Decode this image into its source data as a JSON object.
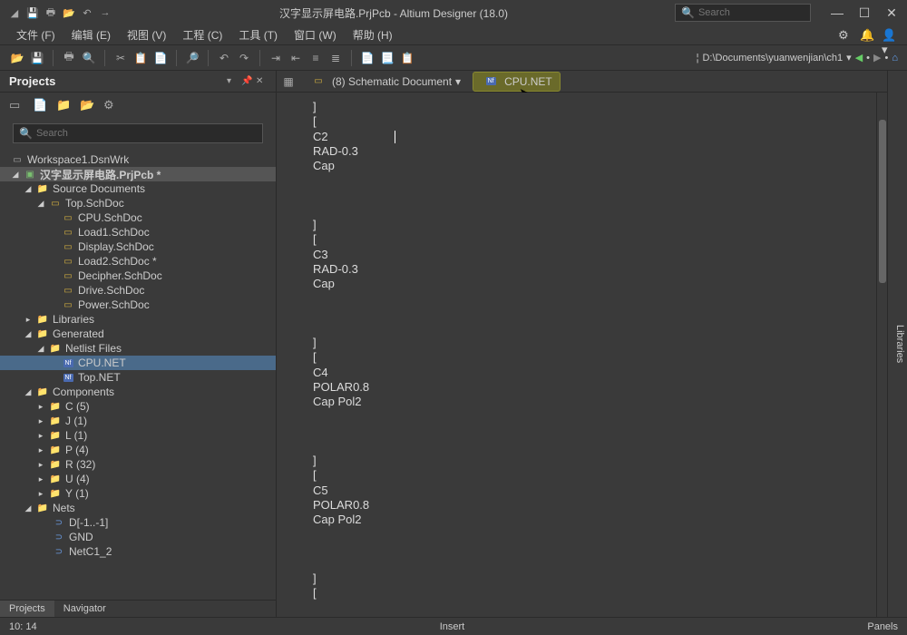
{
  "titlebar": {
    "title": "汉字显示屏电路.PrjPcb - Altium Designer (18.0)",
    "search_placeholder": "Search"
  },
  "menubar": {
    "items": [
      "文件 (F)",
      "编辑 (E)",
      "视图 (V)",
      "工程 (C)",
      "工具 (T)",
      "窗口 (W)",
      "帮助 (H)"
    ]
  },
  "toolbar_right": {
    "path": "D:\\Documents\\yuanwenjian\\ch1"
  },
  "projects_panel": {
    "title": "Projects",
    "search_placeholder": "Search"
  },
  "tree": {
    "workspace": "Workspace1.DsnWrk",
    "project": "汉字显示屏电路.PrjPcb *",
    "source_docs_label": "Source Documents",
    "source_docs": [
      "Top.SchDoc",
      "CPU.SchDoc",
      "Load1.SchDoc",
      "Display.SchDoc",
      "Load2.SchDoc *",
      "Decipher.SchDoc",
      "Drive.SchDoc",
      "Power.SchDoc"
    ],
    "libraries_label": "Libraries",
    "generated_label": "Generated",
    "netlist_label": "Netlist Files",
    "netlist_files": [
      "CPU.NET",
      "Top.NET"
    ],
    "components_label": "Components",
    "components": [
      "C (5)",
      "J (1)",
      "L (1)",
      "P (4)",
      "R (32)",
      "U (4)",
      "Y (1)"
    ],
    "nets_label": "Nets",
    "nets": [
      "D[-1..-1]",
      "GND",
      "NetC1_2"
    ]
  },
  "bottom_tabs": [
    "Projects",
    "Navigator"
  ],
  "doc_tabs": {
    "schematic": "(8) Schematic Document",
    "active": "CPU.NET"
  },
  "editor": {
    "content": "]\n[\nC2\nRAD-0.3\nCap\n\n\n\n]\n[\nC3\nRAD-0.3\nCap\n\n\n\n]\n[\nC4\nPOLAR0.8\nCap Pol2\n\n\n\n]\n[\nC5\nPOLAR0.8\nCap Pol2\n\n\n\n]\n["
  },
  "statusbar": {
    "left": "10: 14",
    "center": "Insert",
    "right": "Panels"
  },
  "right_strip": "Libraries"
}
